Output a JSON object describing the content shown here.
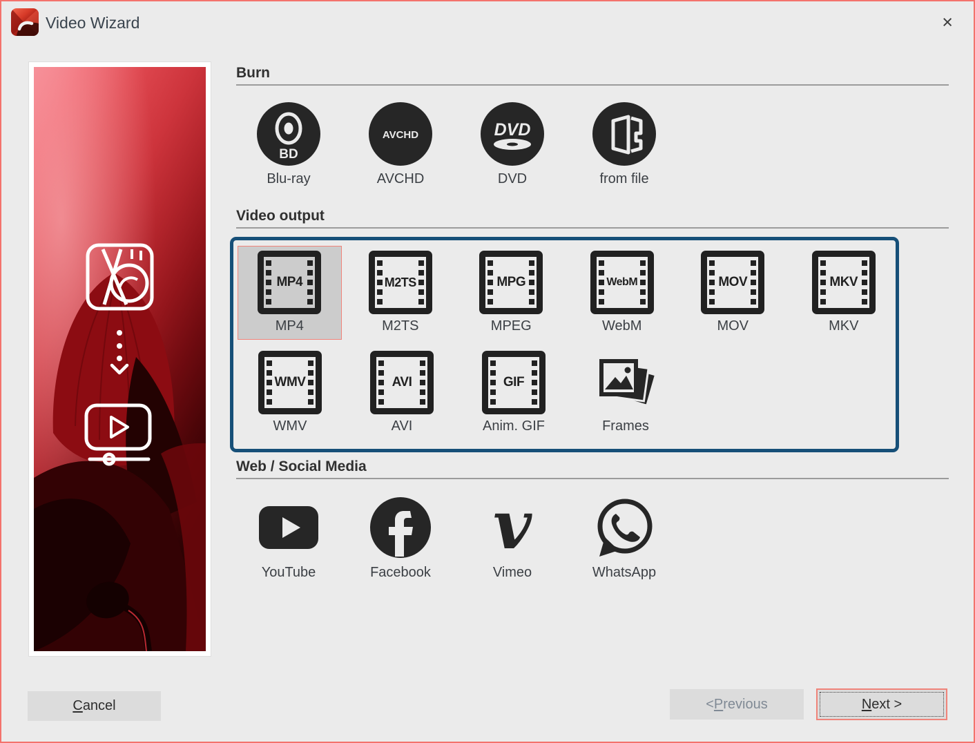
{
  "window": {
    "title": "Video Wizard",
    "close_glyph": "×"
  },
  "sidebar": {
    "artwork": "red-poppy-photo",
    "icons": [
      "app-logo-outline-icon",
      "dotted-arrow-down-icon",
      "video-player-icon"
    ]
  },
  "sections": {
    "burn": {
      "title": "Burn",
      "items": [
        {
          "label": "Blu-ray",
          "icon": "bluray-disc-icon",
          "icon_text": "BD"
        },
        {
          "label": "AVCHD",
          "icon": "avchd-disc-icon",
          "icon_text": "AVCHD"
        },
        {
          "label": "DVD",
          "icon": "dvd-disc-icon",
          "icon_text": "DVD"
        },
        {
          "label": "from file",
          "icon": "disc-from-file-icon"
        }
      ]
    },
    "video_output": {
      "title": "Video output",
      "selected": "MP4",
      "items": [
        {
          "label": "MP4",
          "icon": "filmstrip-icon",
          "icon_text": "MP4",
          "selected": true
        },
        {
          "label": "M2TS",
          "icon": "filmstrip-icon",
          "icon_text": "M2TS",
          "selected": false
        },
        {
          "label": "MPEG",
          "icon": "filmstrip-icon",
          "icon_text": "MPG",
          "selected": false
        },
        {
          "label": "WebM",
          "icon": "filmstrip-icon",
          "icon_text": "WebM",
          "selected": false
        },
        {
          "label": "MOV",
          "icon": "filmstrip-icon",
          "icon_text": "MOV",
          "selected": false
        },
        {
          "label": "MKV",
          "icon": "filmstrip-icon",
          "icon_text": "MKV",
          "selected": false
        },
        {
          "label": "WMV",
          "icon": "filmstrip-icon",
          "icon_text": "WMV",
          "selected": false
        },
        {
          "label": "AVI",
          "icon": "filmstrip-icon",
          "icon_text": "AVI",
          "selected": false
        },
        {
          "label": "Anim. GIF",
          "icon": "filmstrip-icon",
          "icon_text": "GIF",
          "selected": false
        },
        {
          "label": "Frames",
          "icon": "frames-icon",
          "selected": false
        }
      ]
    },
    "web_social": {
      "title": "Web / Social Media",
      "items": [
        {
          "label": "YouTube",
          "icon": "youtube-icon"
        },
        {
          "label": "Facebook",
          "icon": "facebook-icon"
        },
        {
          "label": "Vimeo",
          "icon": "vimeo-icon"
        },
        {
          "label": "WhatsApp",
          "icon": "whatsapp-icon"
        }
      ]
    }
  },
  "buttons": {
    "cancel": {
      "pre": "",
      "mn": "C",
      "post": "ancel"
    },
    "previous": {
      "pre": "< ",
      "mn": "P",
      "post": "revious"
    },
    "next": {
      "pre": "",
      "mn": "N",
      "post": "ext >"
    }
  },
  "colors": {
    "window_border": "#f4726c",
    "selection_border": "#f08379",
    "selection_background": "#cccccc",
    "group_border": "#164f78",
    "icon_dark": "#262626",
    "background": "#ebebeb",
    "button_background": "#dcdcdc"
  }
}
